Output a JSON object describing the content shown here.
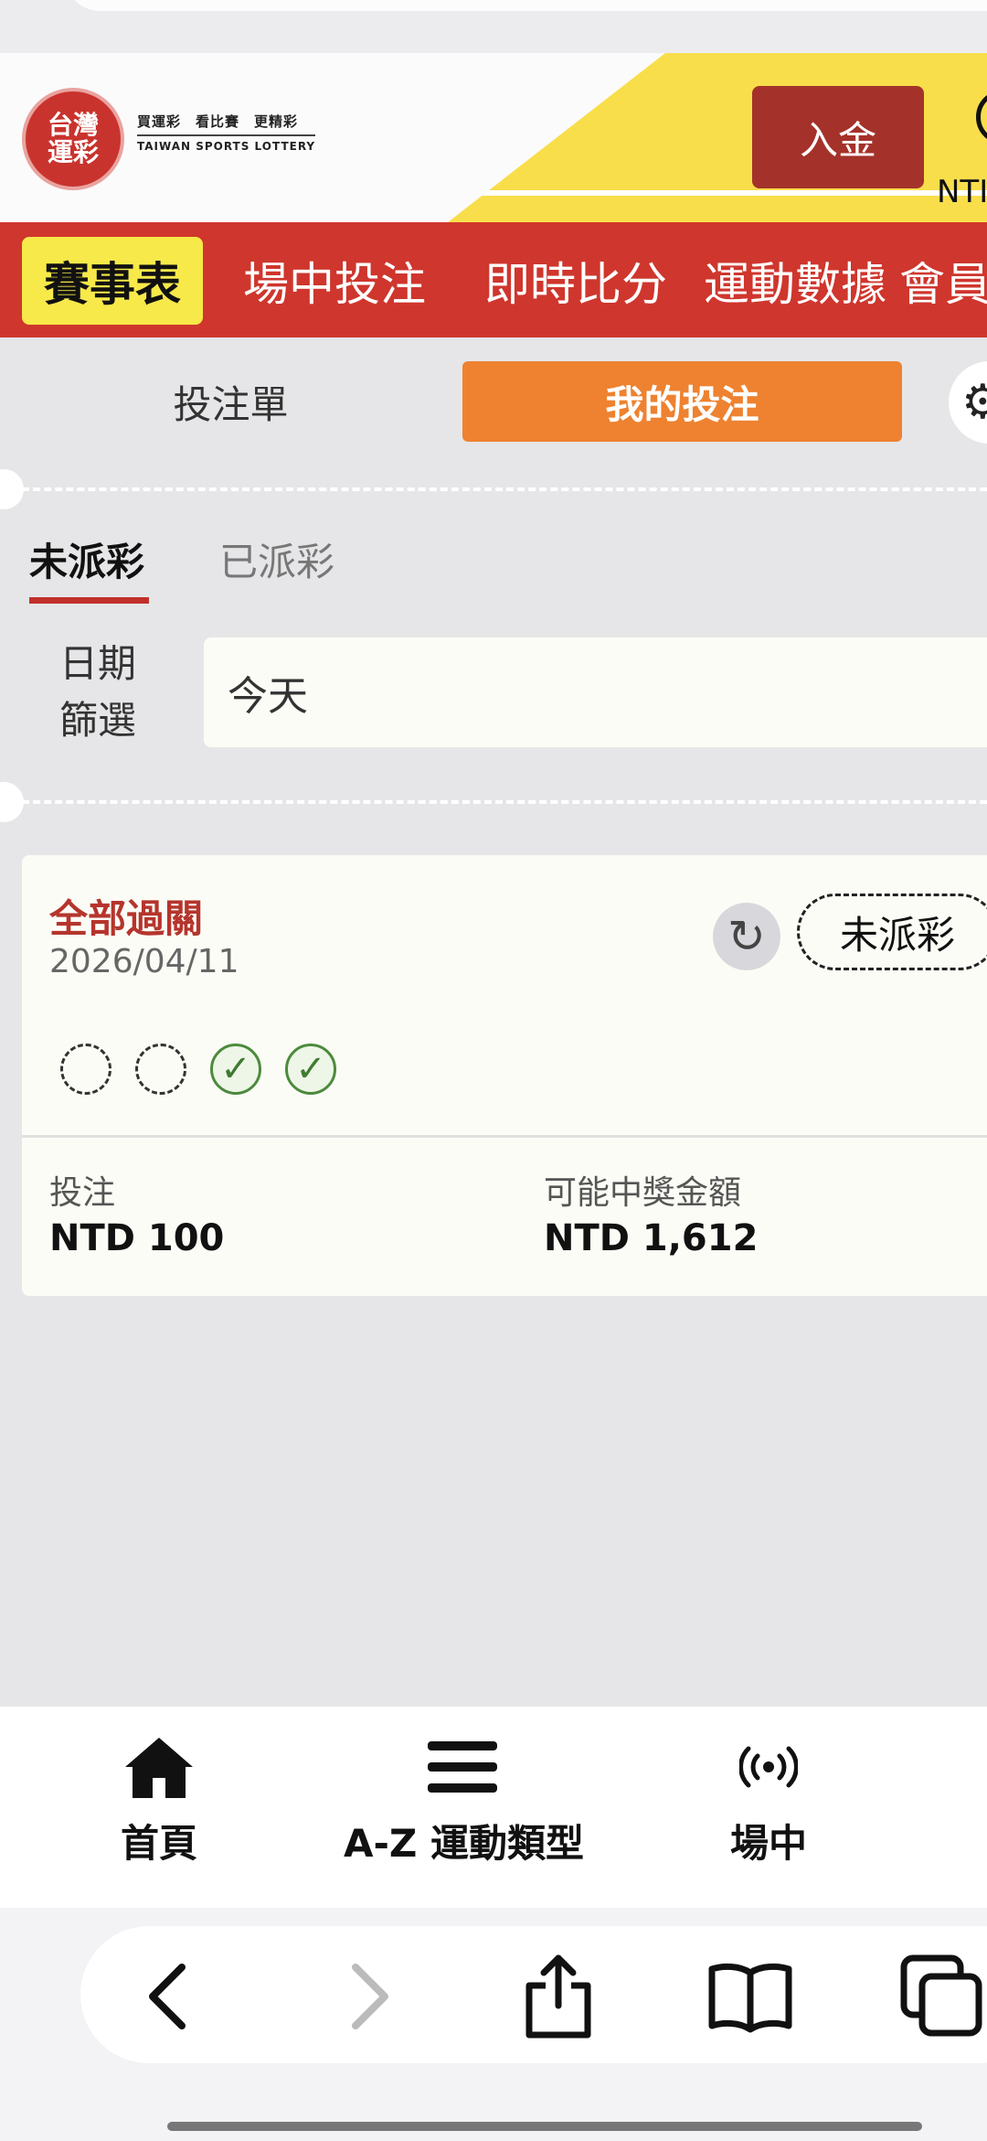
{
  "header": {
    "logo_text": "台灣運彩",
    "slogan": "買運彩　看比賽　更精彩",
    "slogan_en": "TAIWAN SPORTS LOTTERY",
    "deposit_label": "入金",
    "currency_corner": "NTI"
  },
  "nav": {
    "tabs": [
      {
        "label": "賽事表",
        "active": true
      },
      {
        "label": "場中投注",
        "active": false
      },
      {
        "label": "即時比分",
        "active": false
      },
      {
        "label": "運動數據",
        "active": false
      },
      {
        "label": "會員",
        "active": false
      }
    ]
  },
  "slip": {
    "tab_betslip": "投注單",
    "tab_mybets": "我的投注",
    "status_unsettled": "未派彩",
    "status_settled": "已派彩",
    "date_filter_label": "日期篩選",
    "date_filter_value": "今天"
  },
  "bet_card": {
    "type": "全部過關",
    "date": "2026/04/11",
    "status": "未派彩",
    "legs": [
      "pending",
      "pending",
      "won",
      "won"
    ],
    "stake_label": "投注",
    "stake_value": "NTD 100",
    "payout_label": "可能中獎金額",
    "payout_value": "NTD 1,612"
  },
  "bottom_nav": {
    "items": [
      {
        "label": "首頁",
        "icon": "home-icon"
      },
      {
        "label": "A-Z 運動類型",
        "icon": "menu-icon"
      },
      {
        "label": "場中",
        "icon": "live-broadcast-icon"
      }
    ]
  },
  "colors": {
    "brand_red": "#cf362d",
    "accent_yellow": "#f7e94a",
    "accent_orange": "#ee8230",
    "won_green": "#4c8a3c"
  }
}
